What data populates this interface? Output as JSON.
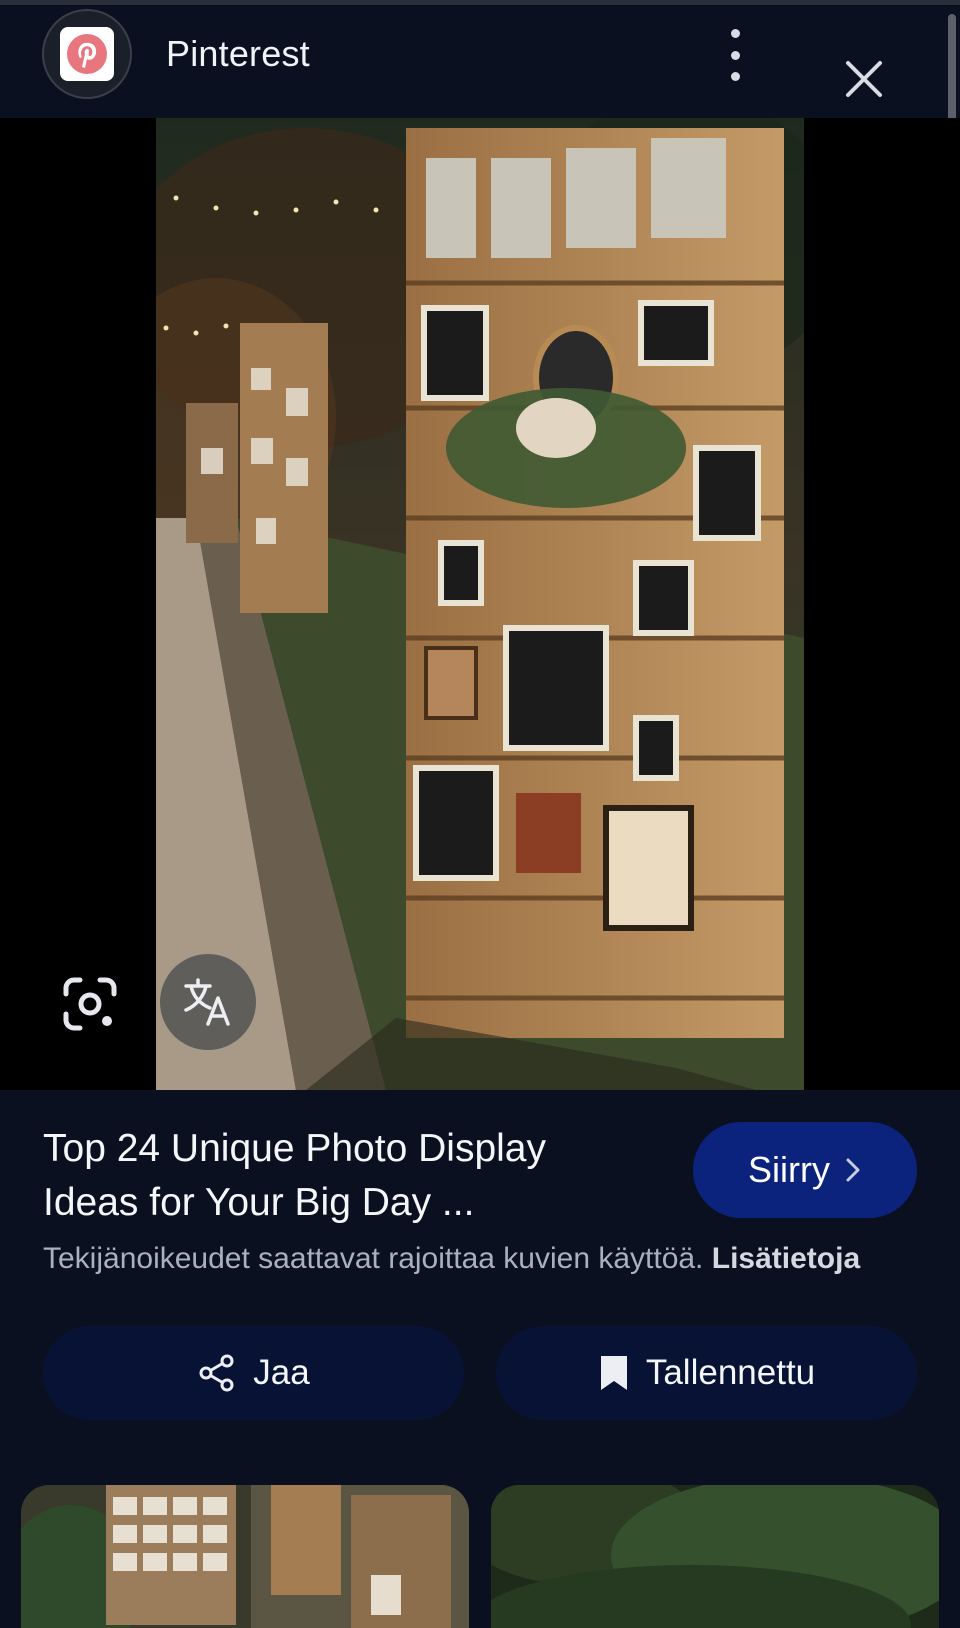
{
  "header": {
    "app_title": "Pinterest",
    "logo_icon": "pinterest-logo-icon",
    "menu_icon": "more-vert-icon",
    "close_icon": "close-icon"
  },
  "image": {
    "lens_icon": "google-lens-icon",
    "translate_icon": "translate-icon"
  },
  "result": {
    "title_line1": "Top 24 Unique Photo Display",
    "title_line2": "Ideas for Your Big Day ...",
    "go_label": "Siirry",
    "copyright_text": "Tekijänoikeudet saattavat rajoittaa kuvien käyttöä.",
    "learn_more": "Lisätietoja"
  },
  "actions": {
    "share_label": "Jaa",
    "save_label": "Tallennettu"
  },
  "colors": {
    "background": "#0b1020",
    "go_button": "#0c237d",
    "action_button": "#071235",
    "pinterest_red": "#e60023"
  }
}
